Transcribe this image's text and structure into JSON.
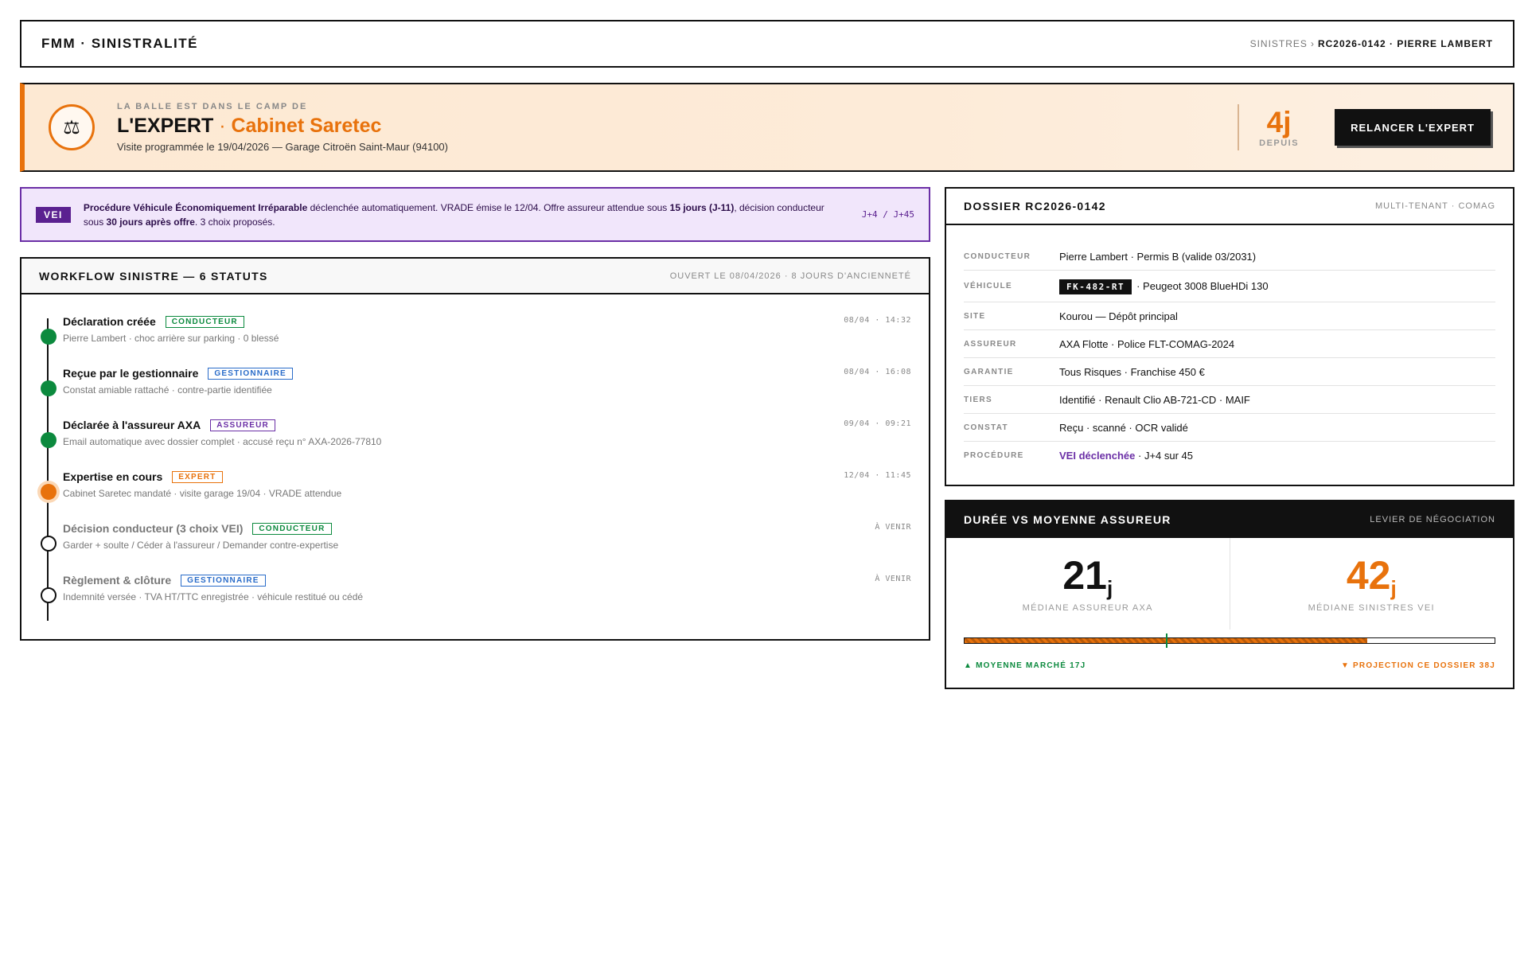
{
  "header": {
    "brand": "FMM · SINISTRALITÉ",
    "breadcrumb_root": "SINISTRES",
    "breadcrumb_sep": "›",
    "breadcrumb_current": "RC2026-0142 · PIERRE LAMBERT"
  },
  "banner": {
    "icon": "scales-icon",
    "kicker": "LA BALLE EST DANS LE CAMP DE",
    "role": "L'EXPERT",
    "separator": " · ",
    "actor": "Cabinet Saretec",
    "subtitle": "Visite programmée le 19/04/2026 — Garage Citroën Saint-Maur (94100)",
    "days": "4j",
    "days_label": "DEPUIS",
    "action_label": "RELANCER L'EXPERT",
    "accent": "#e8720c"
  },
  "vei_notice": {
    "badge": "VEI",
    "text_1": "Procédure Véhicule Économiquement Irréparable",
    "text_2": " déclenchée automatiquement. VRADE émise le 12/04. Offre assureur attendue sous ",
    "text_3": "15 jours (J-11)",
    "text_4": ", décision conducteur sous ",
    "text_5": "30 jours après offre",
    "text_6": ". 3 choix proposés.",
    "range": "J+4 / J+45"
  },
  "workflow": {
    "title": "WORKFLOW SINISTRE — 6 STATUTS",
    "meta": "OUVERT LE 08/04/2026 · 8 JOURS D'ANCIENNETÉ",
    "steps": [
      {
        "title": "Déclaration créée",
        "tag": "CONDUCTEUR",
        "desc": "Pierre Lambert · choc arrière sur parking · 0 blessé",
        "time": "08/04 · 14:32"
      },
      {
        "title": "Reçue par le gestionnaire",
        "tag": "GESTIONNAIRE",
        "desc": "Constat amiable rattaché · contre-partie identifiée",
        "time": "08/04 · 16:08"
      },
      {
        "title": "Déclarée à l'assureur AXA",
        "tag": "ASSUREUR",
        "desc": "Email automatique avec dossier complet · accusé reçu n° AXA-2026-77810",
        "time": "09/04 · 09:21"
      },
      {
        "title": "Expertise en cours",
        "tag": "EXPERT",
        "desc": "Cabinet Saretec mandaté · visite garage 19/04 · VRADE attendue",
        "time": "12/04 · 11:45"
      },
      {
        "title": "Décision conducteur (3 choix VEI)",
        "tag": "CONDUCTEUR",
        "desc": "Garder + soulte / Céder à l'assureur / Demander contre-expertise",
        "time": "À VENIR"
      },
      {
        "title": "Règlement & clôture",
        "tag": "GESTIONNAIRE",
        "desc": "Indemnité versée · TVA HT/TTC enregistrée · véhicule restitué ou cédé",
        "time": "À VENIR"
      }
    ]
  },
  "dossier": {
    "title": "DOSSIER RC2026-0142",
    "meta": "MULTI-TENANT · COMAG",
    "rows": {
      "conducteur": {
        "key": "CONDUCTEUR",
        "value": "Pierre Lambert · Permis B (valide 03/2031)"
      },
      "vehicule": {
        "key": "VÉHICULE",
        "plate": "FK-482-RT",
        "value": "· Peugeot 3008 BlueHDi 130"
      },
      "site": {
        "key": "SITE",
        "value": "Kourou — Dépôt principal"
      },
      "assureur": {
        "key": "ASSUREUR",
        "value": "AXA Flotte · Police FLT-COMAG-2024"
      },
      "garantie": {
        "key": "GARANTIE",
        "value": "Tous Risques · Franchise 450 €"
      },
      "tiers": {
        "key": "TIERS",
        "value": "Identifié · Renault Clio AB-721-CD · MAIF"
      },
      "constat": {
        "key": "CONSTAT",
        "value": "Reçu · scanné · OCR validé"
      },
      "procedure": {
        "key": "PROCÉDURE",
        "link": "VEI déclenchée",
        "value": " · J+4 sur 45"
      }
    }
  },
  "duree": {
    "title": "DURÉE VS MOYENNE ASSUREUR",
    "meta": "LEVIER DE NÉGOCIATION",
    "stat_a": {
      "value": "21",
      "unit": "j",
      "label": "MÉDIANE ASSUREUR AXA"
    },
    "stat_b": {
      "value": "42",
      "unit": "j",
      "label": "MÉDIANE SINISTRES VEI"
    },
    "bar_fill_fraction": 0.76,
    "market_marker_fraction": 0.38,
    "legend_left": "▲ MOYENNE MARCHÉ 17J",
    "legend_right": "▼ PROJECTION CE DOSSIER 38J"
  }
}
